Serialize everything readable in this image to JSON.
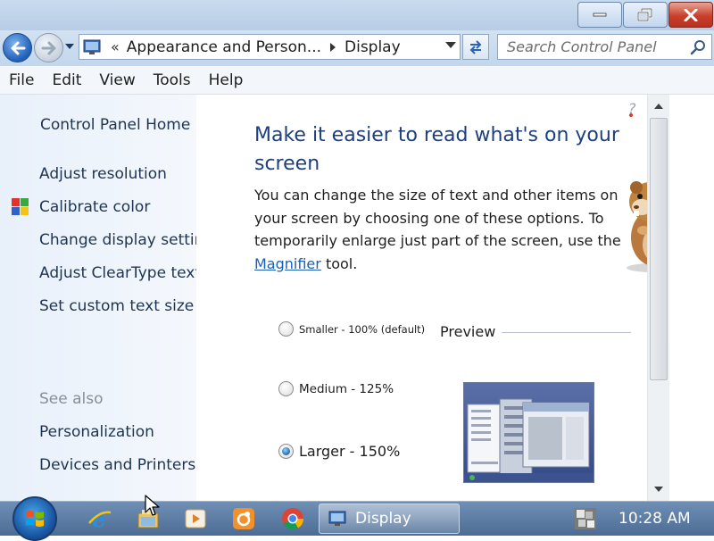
{
  "window": {
    "title_buttons": [
      "minimize-icon",
      "maximize-icon",
      "close-icon"
    ]
  },
  "address": {
    "chevron": "«",
    "crumbs": [
      "Appearance and Person...",
      "Display"
    ],
    "search_placeholder": "Search Control Panel"
  },
  "menu": [
    "File",
    "Edit",
    "View",
    "Tools",
    "Help"
  ],
  "left_pane": {
    "home": "Control Panel Home",
    "tasks": [
      "Adjust resolution",
      "Calibrate color",
      "Change display settings",
      "Adjust ClearType text",
      "Set custom text size (DPI)"
    ],
    "see_also_heading": "See also",
    "see_also": [
      "Personalization",
      "Devices and Printers"
    ]
  },
  "content": {
    "heading": "Make it easier to read what's on your screen",
    "desc_before": "You can change the size of text and other items on your screen by choosing one of these options. To temporarily enlarge just part of the screen, use the ",
    "desc_link": "Magnifier",
    "desc_after": " tool.",
    "options": [
      {
        "label": "Smaller - 100% (default)",
        "checked": false
      },
      {
        "label": "Medium - 125%",
        "checked": false
      },
      {
        "label": "Larger - 150%",
        "checked": true
      }
    ],
    "preview_label": "Preview"
  },
  "taskbar": {
    "pinned": [
      "internet-explorer-icon",
      "file-explorer-icon",
      "media-player-icon",
      "uc-browser-icon",
      "chrome-icon"
    ],
    "active_task": "Display",
    "clock": "10:28 AM"
  },
  "colors": {
    "heading": "#1e3f7d",
    "link": "#1a5fb4",
    "taskbar": "#5a7aa3"
  }
}
